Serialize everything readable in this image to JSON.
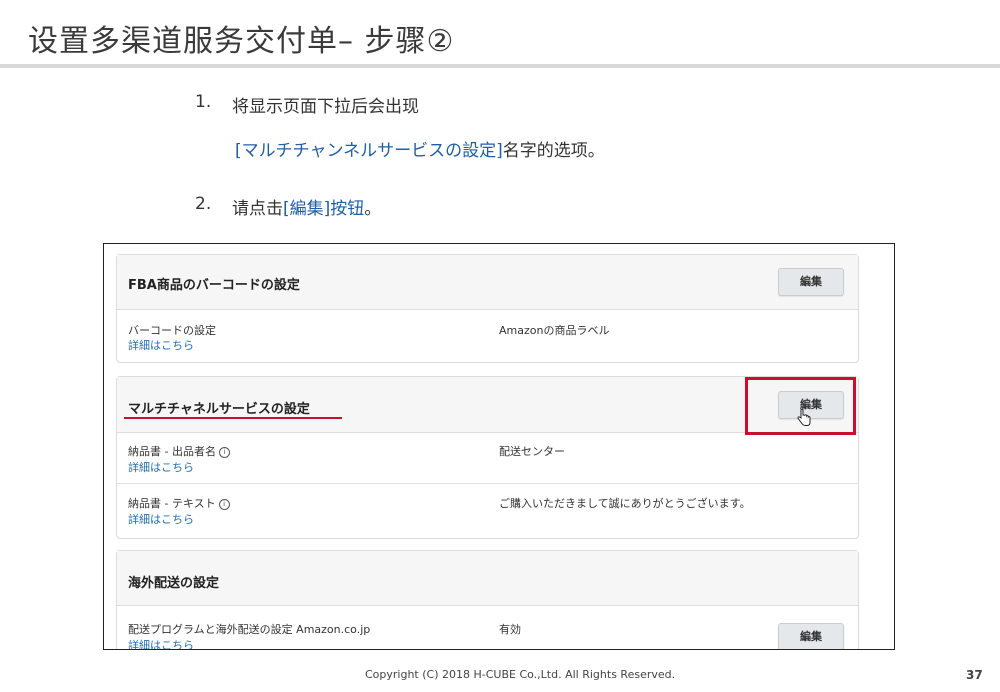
{
  "slide": {
    "title": "设置多渠道服务交付单– 步骤②",
    "steps": [
      {
        "num": "1.",
        "line1": "将显示页面下拉后会出现",
        "line2_blue": "[マルチチャンネルサービスの設定]",
        "line2_rest": "名字的选项。"
      },
      {
        "num": "2.",
        "text_pre": "请点击",
        "text_blue": "[編集]按钮",
        "text_post": "。"
      }
    ],
    "copyright": "Copyright (C) 2018 H-CUBE Co.,Ltd. All Rights Reserved.",
    "page_number": "37"
  },
  "screenshot": {
    "sections": [
      {
        "title": "FBA商品のバーコードの設定",
        "edit_label": "編集",
        "rows": [
          {
            "label": "バーコードの設定",
            "link": "詳細はこちら",
            "value": "Amazonの商品ラベル"
          }
        ]
      },
      {
        "title": "マルチチャネルサービスの設定",
        "edit_label": "編集",
        "rows": [
          {
            "label": "納品書 - 出品者名",
            "info": "i",
            "link": "詳細はこちら",
            "value": "配送センター"
          },
          {
            "label": "納品書 - テキスト",
            "info": "i",
            "link": "詳細はこちら",
            "value": "ご購入いただきまして誠にありがとうございます。"
          }
        ]
      },
      {
        "title": "海外配送の設定",
        "edit_label": "編集",
        "rows": [
          {
            "label": "配送プログラムと海外配送の設定 Amazon.co.jp",
            "link": "詳細はこちら",
            "value": "有効"
          }
        ]
      }
    ]
  },
  "colors": {
    "highlight_red": "#c8102e",
    "link_blue": "#1f6fb5",
    "accent_blue": "#1f5fa8"
  }
}
